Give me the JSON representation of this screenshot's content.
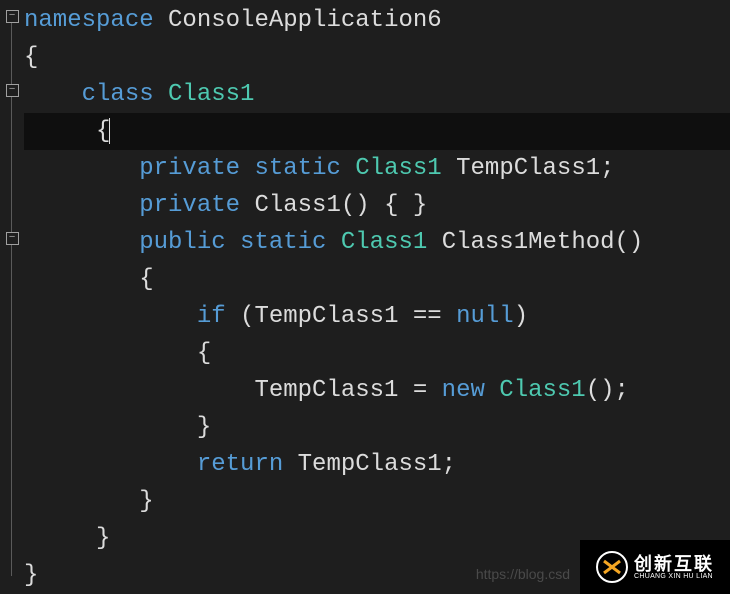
{
  "code": {
    "tokens": [
      [
        [
          "kw",
          "namespace"
        ],
        [
          "default",
          " "
        ],
        [
          "default",
          "ConsoleApplication6"
        ]
      ],
      [
        [
          "default",
          "{"
        ]
      ],
      [
        [
          "default",
          "    "
        ],
        [
          "kw",
          "class"
        ],
        [
          "default",
          " "
        ],
        [
          "type",
          "Class1"
        ]
      ],
      [
        [
          "default",
          "     {"
        ]
      ],
      [
        [
          "default",
          "        "
        ],
        [
          "kw",
          "private"
        ],
        [
          "default",
          " "
        ],
        [
          "kw",
          "static"
        ],
        [
          "default",
          " "
        ],
        [
          "type",
          "Class1"
        ],
        [
          "default",
          " TempClass1;"
        ]
      ],
      [
        [
          "default",
          "        "
        ],
        [
          "kw",
          "private"
        ],
        [
          "default",
          " Class1() { }"
        ]
      ],
      [
        [
          "default",
          "        "
        ],
        [
          "kw",
          "public"
        ],
        [
          "default",
          " "
        ],
        [
          "kw",
          "static"
        ],
        [
          "default",
          " "
        ],
        [
          "type",
          "Class1"
        ],
        [
          "default",
          " Class1Method()"
        ]
      ],
      [
        [
          "default",
          "        {"
        ]
      ],
      [
        [
          "default",
          "            "
        ],
        [
          "kw",
          "if"
        ],
        [
          "default",
          " (TempClass1 == "
        ],
        [
          "kw",
          "null"
        ],
        [
          "default",
          ")"
        ]
      ],
      [
        [
          "default",
          "            {"
        ]
      ],
      [
        [
          "default",
          "                TempClass1 = "
        ],
        [
          "kw",
          "new"
        ],
        [
          "default",
          " "
        ],
        [
          "type",
          "Class1"
        ],
        [
          "default",
          "();"
        ]
      ],
      [
        [
          "default",
          "            }"
        ]
      ],
      [
        [
          "default",
          "            "
        ],
        [
          "kw",
          "return"
        ],
        [
          "default",
          " TempClass1;"
        ]
      ],
      [
        [
          "default",
          "        }"
        ]
      ],
      [
        [
          "default",
          "     }"
        ]
      ],
      [
        [
          "default",
          "}"
        ]
      ]
    ],
    "fold_lines": [
      0,
      2,
      6
    ],
    "current_line": 3
  },
  "watermark": "https://blog.csd",
  "badge": {
    "cn": "创新互联",
    "en": "CHUANG XIN HU LIAN"
  }
}
